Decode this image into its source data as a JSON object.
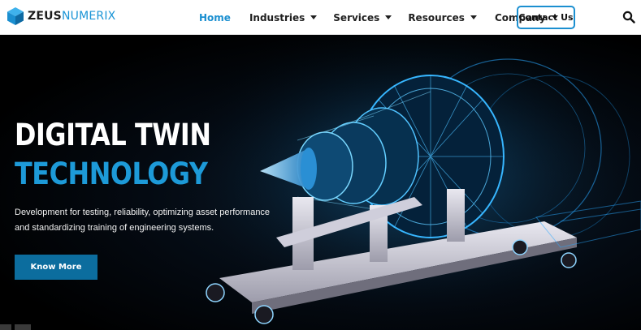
{
  "brand": {
    "name_bold": "ZEUS",
    "name_light": "NUMERIX"
  },
  "nav": {
    "items": [
      {
        "label": "Home",
        "active": true,
        "dropdown": false
      },
      {
        "label": "Industries",
        "active": false,
        "dropdown": true
      },
      {
        "label": "Services",
        "active": false,
        "dropdown": true
      },
      {
        "label": "Resources",
        "active": false,
        "dropdown": true
      },
      {
        "label": "Company",
        "active": false,
        "dropdown": true
      }
    ],
    "contact_label": "Contact Us",
    "search_icon": "search-icon"
  },
  "hero": {
    "headline_line1": "DIGITAL TWIN",
    "headline_line2": "TECHNOLOGY",
    "description_line1": "Development for testing, reliability, optimizing asset performance",
    "description_line2": "and standardizing training of engineering systems.",
    "cta_label": "Know More",
    "image": "jet-engine-digital-twin-wireframe"
  },
  "colors": {
    "accent": "#1b8fd0",
    "headline_accent": "#1d9ad8",
    "cta_bg": "#0c6d9e",
    "hero_bg": "#000000"
  }
}
